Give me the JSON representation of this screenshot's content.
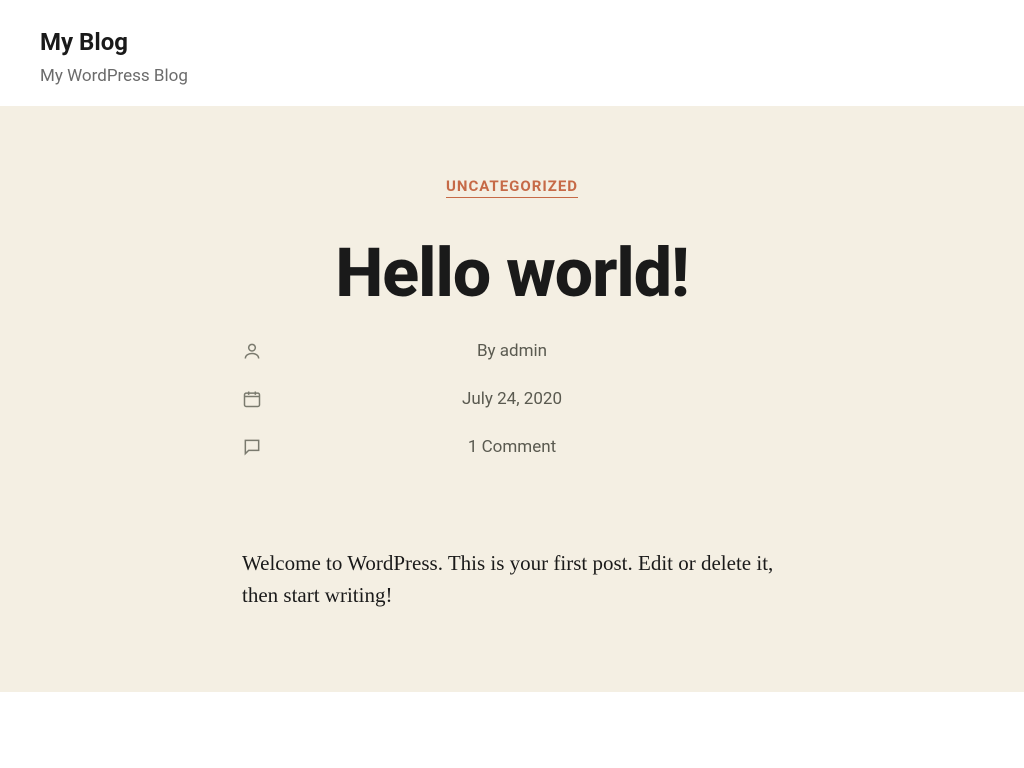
{
  "header": {
    "site_title": "My Blog",
    "tagline": "My WordPress Blog"
  },
  "post": {
    "category": "UNCATEGORIZED",
    "title": "Hello world!",
    "author_by": "By ",
    "author_name": "admin",
    "date": "July 24, 2020",
    "comments": "1 Comment",
    "body": "Welcome to WordPress. This is your first post. Edit or delete it, then start writing!"
  }
}
